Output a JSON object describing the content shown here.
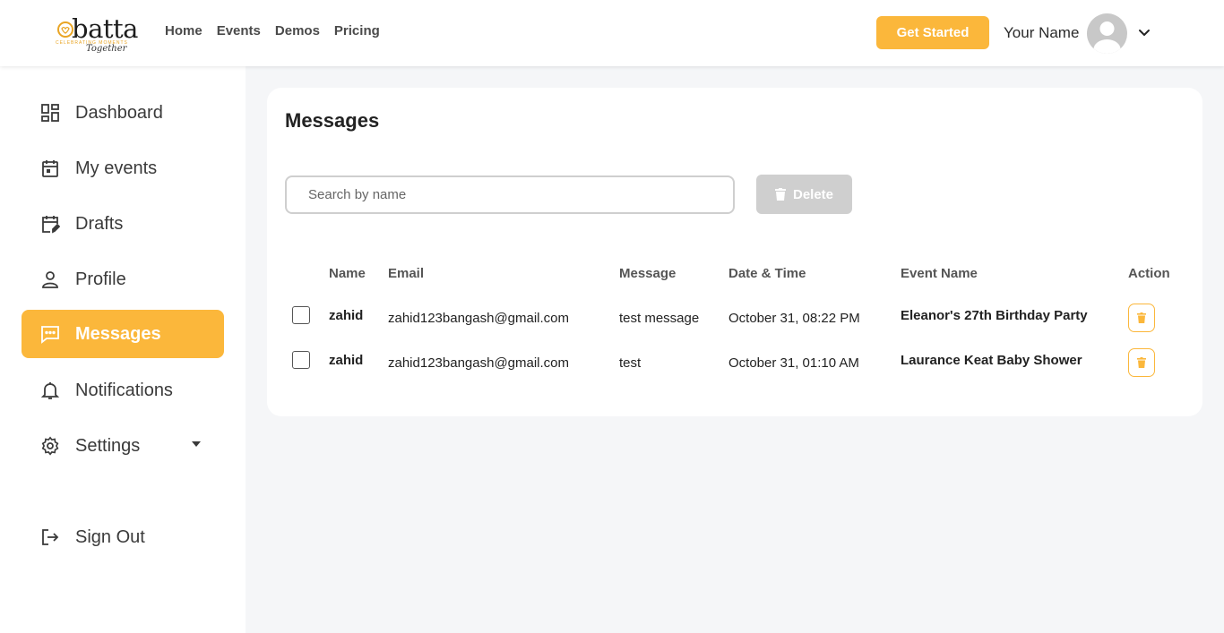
{
  "header": {
    "logo": {
      "text": "batta",
      "tagline": "CELEBRATING MOMENTS",
      "script": "Together"
    },
    "nav": [
      "Home",
      "Events",
      "Demos",
      "Pricing"
    ],
    "get_started": "Get Started",
    "user_name": "Your Name"
  },
  "sidebar": {
    "items": [
      {
        "label": "Dashboard",
        "icon": "dashboard-icon"
      },
      {
        "label": "My events",
        "icon": "calendar-icon"
      },
      {
        "label": "Drafts",
        "icon": "calendar-edit-icon"
      },
      {
        "label": "Profile",
        "icon": "user-icon"
      },
      {
        "label": "Messages",
        "icon": "message-icon",
        "active": true
      },
      {
        "label": "Notifications",
        "icon": "bell-icon"
      },
      {
        "label": "Settings",
        "icon": "gear-icon"
      },
      {
        "label": "Sign Out",
        "icon": "sign-out-icon"
      }
    ]
  },
  "main": {
    "title": "Messages",
    "search": {
      "placeholder": "Search by name",
      "value": ""
    },
    "delete_label": "Delete",
    "columns": [
      "Name",
      "Email",
      "Message",
      "Date & Time",
      "Event Name",
      "Action"
    ],
    "rows": [
      {
        "name": "zahid",
        "email": "zahid123bangash@gmail.com",
        "message": "test message",
        "datetime": "October 31, 08:22 PM",
        "event": "Eleanor's 27th Birthday Party"
      },
      {
        "name": "zahid",
        "email": "zahid123bangash@gmail.com",
        "message": "test",
        "datetime": "October 31, 01:10 AM",
        "event": "Laurance Keat Baby Shower"
      }
    ]
  },
  "colors": {
    "accent": "#fbb73b",
    "disabled": "#cfcfcf",
    "background": "#f5f6f8"
  }
}
